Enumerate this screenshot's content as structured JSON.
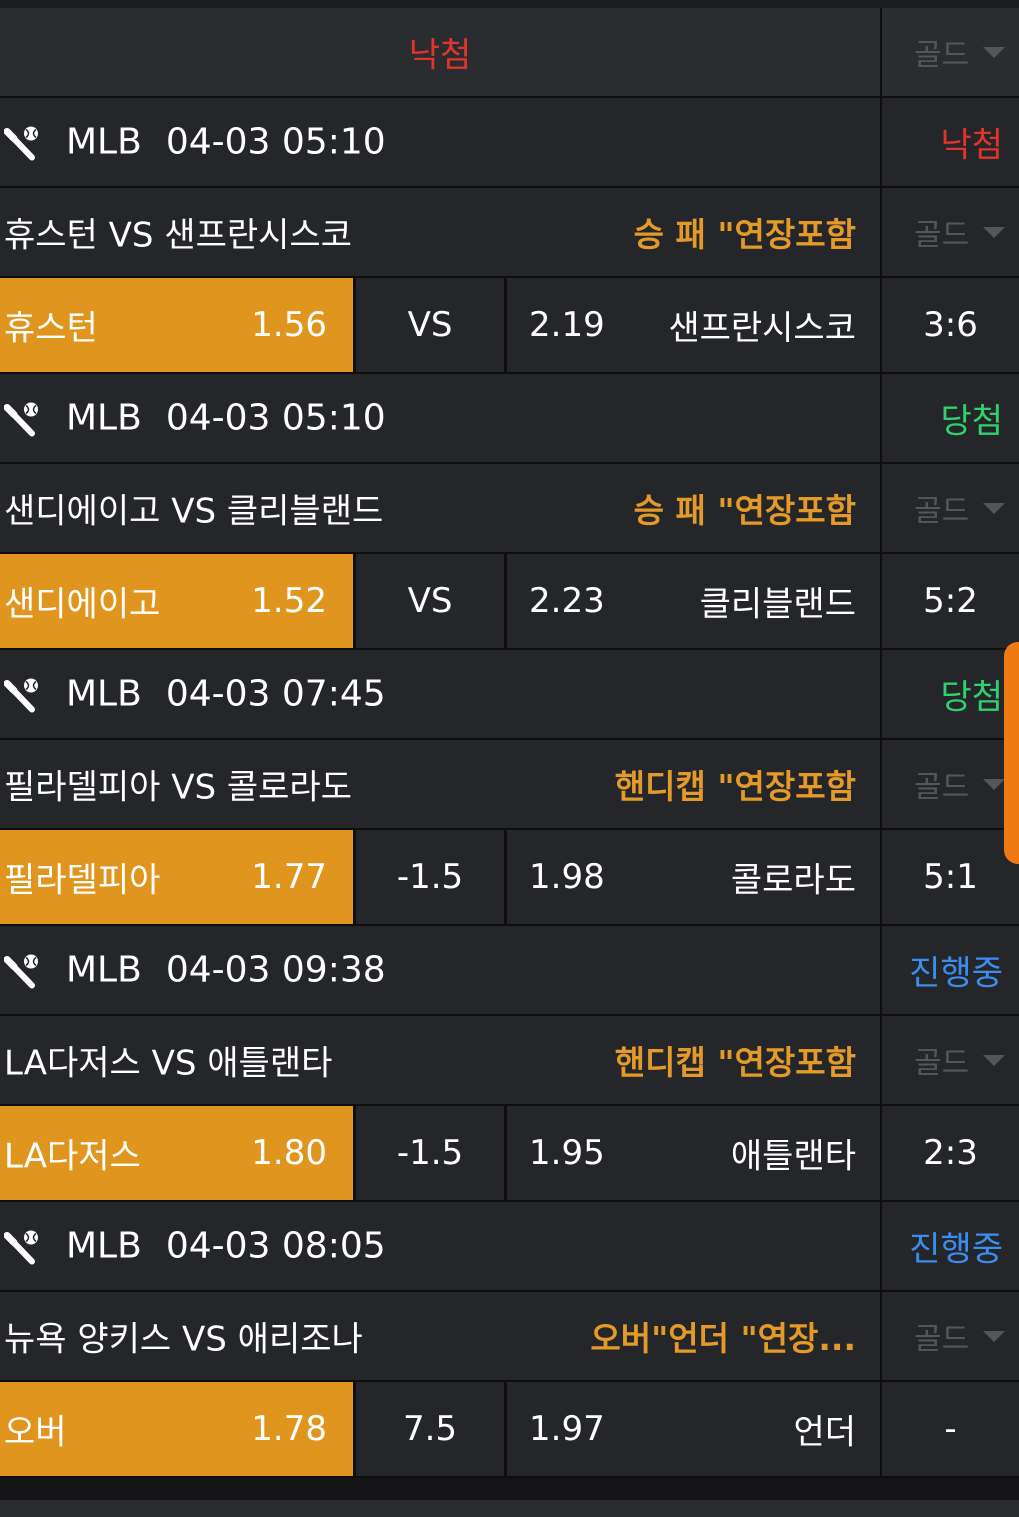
{
  "header": {
    "result_label": "낙첨",
    "filter_label": "골드"
  },
  "colors": {
    "lose": "#e0342c",
    "win": "#2fd06e",
    "live": "#3a8ef0",
    "accent": "#e0961e",
    "bet_type": "#e39a28"
  },
  "matches": [
    {
      "icon": "baseball-icon",
      "league": "MLB",
      "datetime": "04-03 05:10",
      "status": "낙첨",
      "status_kind": "lose",
      "name": "휴스턴 VS 샌프란시스코",
      "bet_type": "승 패 \"연장포함",
      "filter_label": "골드",
      "home": "휴스턴",
      "home_odd": "1.56",
      "middle": "VS",
      "away_odd": "2.19",
      "away": "샌프란시스코",
      "score": "3:6"
    },
    {
      "icon": "baseball-icon",
      "league": "MLB",
      "datetime": "04-03 05:10",
      "status": "당첨",
      "status_kind": "win",
      "name": "샌디에이고 VS 클리블랜드",
      "bet_type": "승 패 \"연장포함",
      "filter_label": "골드",
      "home": "샌디에이고",
      "home_odd": "1.52",
      "middle": "VS",
      "away_odd": "2.23",
      "away": "클리블랜드",
      "score": "5:2"
    },
    {
      "icon": "baseball-icon",
      "league": "MLB",
      "datetime": "04-03 07:45",
      "status": "당첨",
      "status_kind": "win",
      "name": "필라델피아 VS 콜로라도",
      "bet_type": "핸디캡 \"연장포함",
      "filter_label": "골드",
      "home": "필라델피아",
      "home_odd": "1.77",
      "middle": "-1.5",
      "away_odd": "1.98",
      "away": "콜로라도",
      "score": "5:1"
    },
    {
      "icon": "baseball-icon",
      "league": "MLB",
      "datetime": "04-03 09:38",
      "status": "진행중",
      "status_kind": "live",
      "name": "LA다저스 VS 애틀랜타",
      "bet_type": "핸디캡 \"연장포함",
      "filter_label": "골드",
      "home": "LA다저스",
      "home_odd": "1.80",
      "middle": "-1.5",
      "away_odd": "1.95",
      "away": "애틀랜타",
      "score": "2:3"
    },
    {
      "icon": "baseball-icon",
      "league": "MLB",
      "datetime": "04-03 08:05",
      "status": "진행중",
      "status_kind": "live",
      "name": "뉴욕 양키스 VS 애리조나",
      "bet_type": "오버\"언더 \"연장...",
      "filter_label": "골드",
      "home": "오버",
      "home_odd": "1.78",
      "middle": "7.5",
      "away_odd": "1.97",
      "away": "언더",
      "score": "-"
    }
  ]
}
